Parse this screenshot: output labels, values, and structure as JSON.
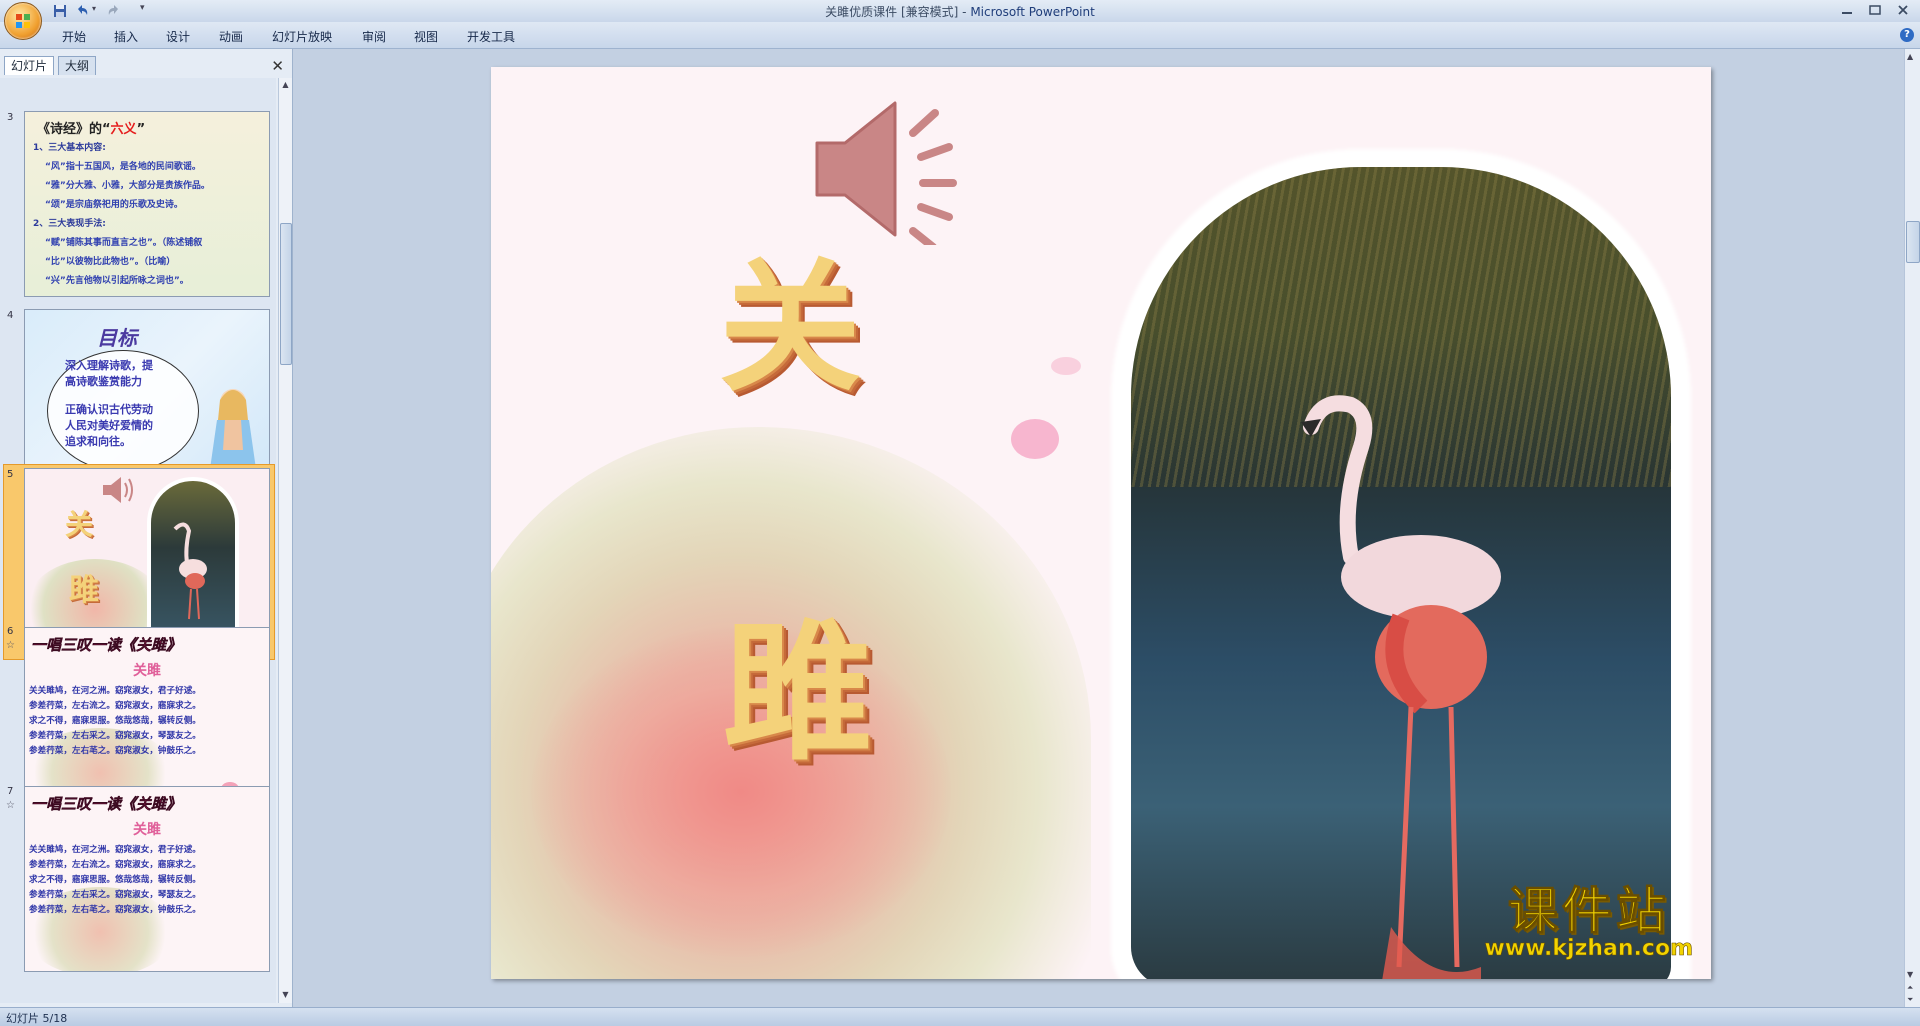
{
  "window": {
    "title_doc": "关雎优质课件 [兼容模式] - ",
    "title_app": "Microsoft PowerPoint"
  },
  "ribbon_tabs": [
    "开始",
    "插入",
    "设计",
    "动画",
    "幻灯片放映",
    "审阅",
    "视图",
    "开发工具"
  ],
  "panel": {
    "tab_slides": "幻灯片",
    "tab_outline": "大纲",
    "close_glyph": "✕"
  },
  "thumbnails": [
    {
      "number": "3",
      "title_pre": "《诗经》的“",
      "title_red": "六义",
      "title_post": "”",
      "lines": [
        "1、三大基本内容:",
        "“风”指十五国风，是各地的民间歌谣。",
        "“雅”分大雅、小雅，大部分是贵族作品。",
        "“颂”是宗庙祭祀用的乐歌及史诗。",
        "2、三大表现手法:",
        "“赋”铺陈其事而直言之也”。（陈述铺叙",
        "“比”以彼物比此物也”。（比喻）",
        "“兴”先言他物以引起所咏之词也”。"
      ]
    },
    {
      "number": "4",
      "heading": "目标",
      "lines": [
        "深入理解诗歌，提",
        "高诗歌鉴赏能力",
        "正确认识古代劳动",
        "人民对美好爱情的",
        "追求和向往。"
      ]
    },
    {
      "number": "5",
      "char1": "关",
      "char2": "雎"
    },
    {
      "number": "6",
      "star": "☆",
      "heading": "一唱三叹一读《关雎》",
      "subheading": "关雎",
      "lines": [
        "关关雎鸠，在河之洲。窈窕淑女，君子好逑。",
        "参差荇菜，左右流之。窈窕淑女，寤寐求之。",
        "求之不得，寤寐思服。悠哉悠哉，辗转反侧。",
        "参差荇菜，左右采之。窈窕淑女，琴瑟友之。",
        "参差荇菜，左右芼之。窈窕淑女，钟鼓乐之。"
      ]
    },
    {
      "number": "7",
      "star": "☆",
      "heading": "一唱三叹一读《关雎》",
      "subheading": "关雎",
      "lines": [
        "关关雎鸠，在河之洲。窈窕淑女，君子好逑。",
        "参差荇菜，左右流之。窈窕淑女，寤寐求之。",
        "求之不得，寤寐思服。悠哉悠哉，辗转反侧。",
        "参差荇菜，左右采之。窈窕淑女，琴瑟友之。",
        "参差荇菜，左右芼之。窈窕淑女，钟鼓乐之。"
      ]
    }
  ],
  "slide": {
    "char1": "关",
    "char2": "雎"
  },
  "watermark": {
    "main": "课件站",
    "url": "www.kjzhan.com"
  },
  "status": {
    "slide_counter": "幻灯片 5/18"
  },
  "colors": {
    "accent_selected": "#f5a623",
    "ribbon_bg": "#d4e1f1",
    "slide_bg": "#fdf3f6",
    "speaker": "#c98686"
  },
  "icons": [
    "office-button-icon",
    "save-icon",
    "undo-icon",
    "redo-icon",
    "customize-qat-icon",
    "minimize-icon",
    "maximize-icon",
    "close-icon",
    "help-icon",
    "speaker-icon"
  ]
}
